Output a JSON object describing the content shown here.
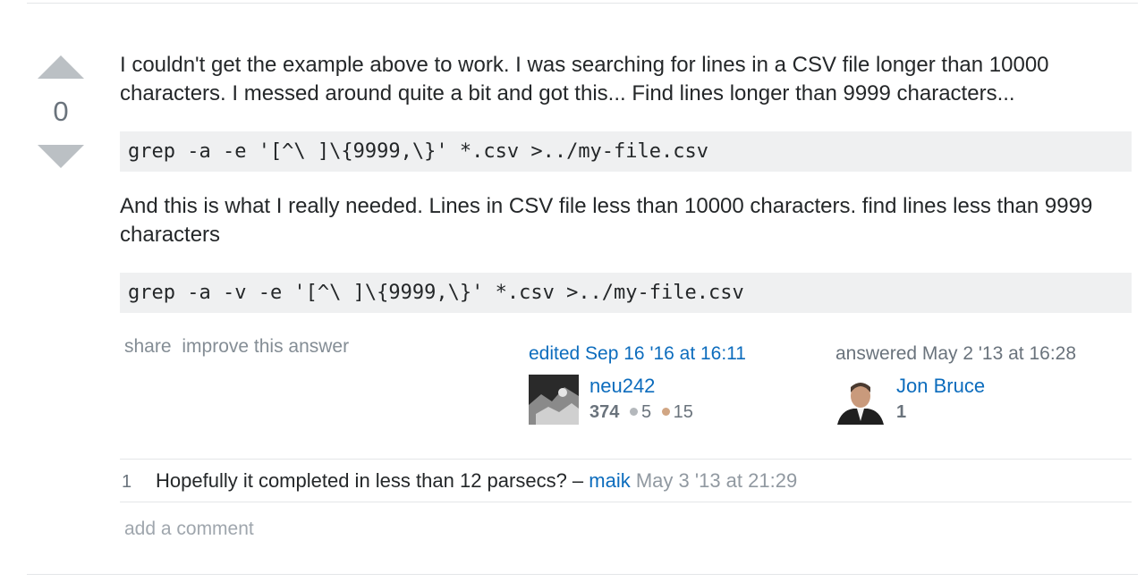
{
  "vote": {
    "score": "0"
  },
  "post": {
    "paragraph1": "I couldn't get the example above to work. I was searching for lines in a CSV file longer than 10000 characters. I messed around quite a bit and got this... Find lines longer than 9999 characters...",
    "code1": "grep -a -e '[^\\ ]\\{9999,\\}' *.csv >../my-file.csv",
    "paragraph2": "And this is what I really needed. Lines in CSV file less than 10000 characters. find lines less than 9999 characters",
    "code2": "grep -a -v -e '[^\\ ]\\{9999,\\}' *.csv >../my-file.csv"
  },
  "menu": {
    "share": "share",
    "improve": "improve this answer"
  },
  "editor": {
    "action": "edited Sep 16 '16 at 16:11",
    "name": "neu242",
    "reputation": "374",
    "silver": "5",
    "bronze": "15"
  },
  "author": {
    "action": "answered May 2 '13 at 16:28",
    "name": "Jon Bruce",
    "reputation": "1"
  },
  "comments": [
    {
      "score": "1",
      "text": "Hopefully it completed in less than 12 parsecs? – ",
      "user": "maik",
      "date": "May 3 '13 at 21:29"
    }
  ],
  "add_comment": "add a comment",
  "colors": {
    "link": "#0c6cbd",
    "silver": "#b4b8bc",
    "bronze": "#d1a684",
    "code_bg": "#eff0f1"
  }
}
